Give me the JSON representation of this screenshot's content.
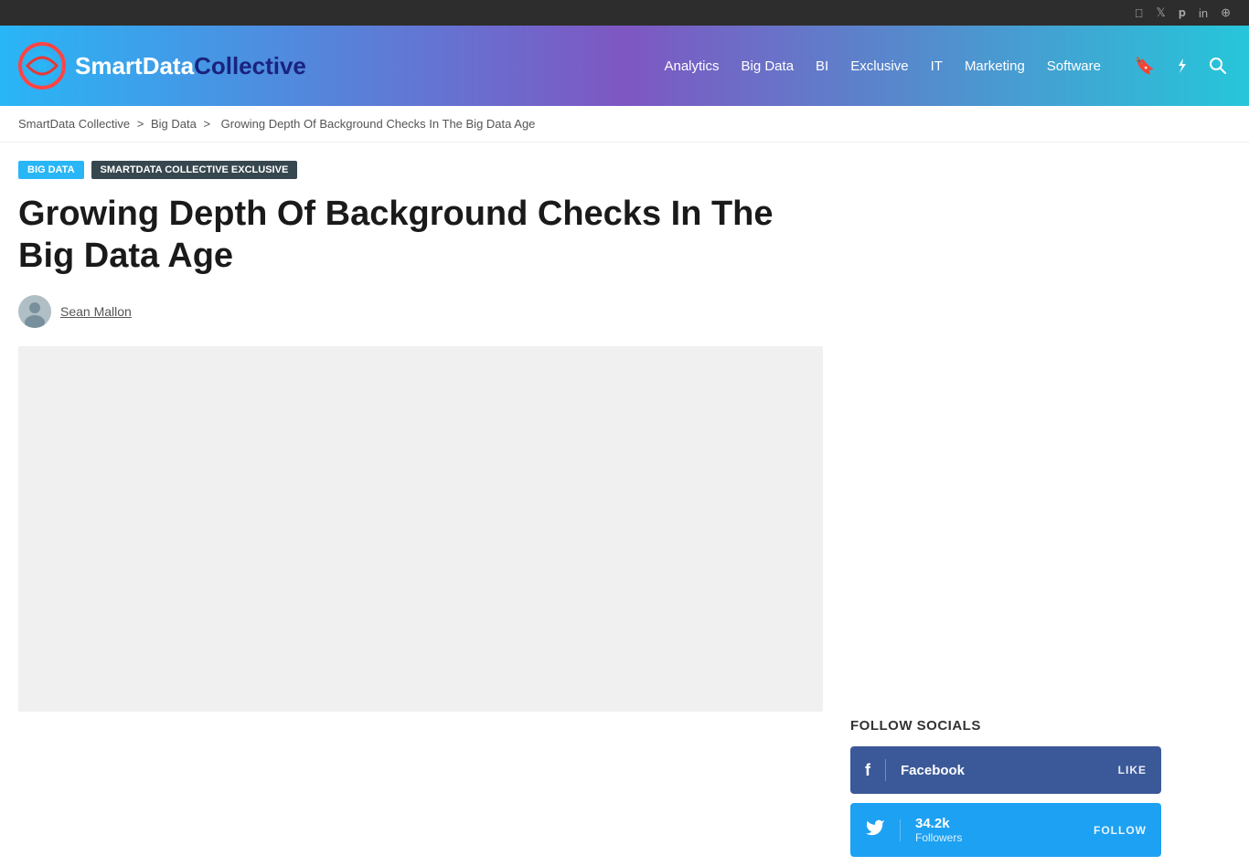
{
  "topbar": {
    "social_links": [
      "facebook",
      "twitter",
      "pinterest",
      "linkedin",
      "rss"
    ]
  },
  "header": {
    "logo_text_smart": "SmartData",
    "logo_text_collective": "Collective",
    "nav_items": [
      {
        "label": "Analytics",
        "href": "#"
      },
      {
        "label": "Big Data",
        "href": "#"
      },
      {
        "label": "BI",
        "href": "#"
      },
      {
        "label": "Exclusive",
        "href": "#"
      },
      {
        "label": "IT",
        "href": "#"
      },
      {
        "label": "Marketing",
        "href": "#"
      },
      {
        "label": "Software",
        "href": "#"
      }
    ]
  },
  "breadcrumb": {
    "items": [
      {
        "label": "SmartData Collective",
        "href": "#"
      },
      {
        "label": "Big Data",
        "href": "#"
      },
      {
        "label": "Growing Depth Of Background Checks In The Big Data Age",
        "href": "#"
      }
    ],
    "separator": ">"
  },
  "article": {
    "tags": [
      {
        "label": "BIG DATA",
        "style": "blue"
      },
      {
        "label": "SMARTDATA COLLECTIVE EXCLUSIVE",
        "style": "dark"
      }
    ],
    "title": "Growing Depth Of Background Checks In The Big Data Age",
    "author_name": "Sean Mallon",
    "author_avatar": "👤"
  },
  "sidebar": {
    "follow_socials_title": "FOLLOW SOCIALS",
    "social_cards": [
      {
        "platform": "facebook",
        "label": "Facebook",
        "action": "LIKE",
        "style": "facebook"
      },
      {
        "platform": "twitter",
        "followers": "34.2k",
        "followers_label": "Followers",
        "action": "FOLLOW",
        "style": "twitter"
      }
    ]
  }
}
